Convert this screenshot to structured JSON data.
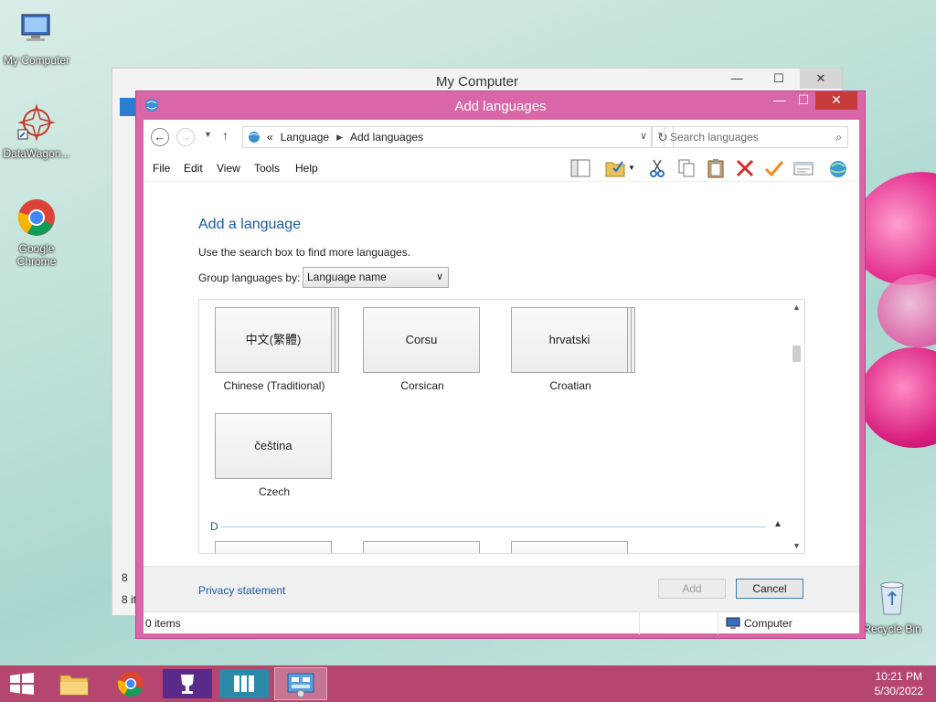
{
  "desktop": {
    "icons": [
      {
        "label": "My Computer"
      },
      {
        "label": "DataWagon..."
      },
      {
        "label": "Google Chrome"
      },
      {
        "label": "Recycle Bin"
      }
    ]
  },
  "back_window": {
    "title": "My Computer",
    "frag_top": "8",
    "frag_bottom": "8 it"
  },
  "dialog": {
    "title": "Add languages",
    "breadcrumb": {
      "prefix": "«",
      "items": [
        "Language",
        "Add languages"
      ]
    },
    "search_placeholder": "Search languages",
    "menu": [
      "File",
      "Edit",
      "View",
      "Tools",
      "Help"
    ],
    "heading": "Add a language",
    "hint": "Use the search box to find more languages.",
    "group_label": "Group languages by:",
    "group_value": "Language name",
    "languages": [
      {
        "native": "中文(繁體)",
        "name": "Chinese (Traditional)"
      },
      {
        "native": "Corsu",
        "name": "Corsican"
      },
      {
        "native": "hrvatski",
        "name": "Croatian"
      },
      {
        "native": "čeština",
        "name": "Czech"
      }
    ],
    "next_group": "D",
    "privacy": "Privacy statement",
    "add_button": "Add",
    "cancel_button": "Cancel",
    "status_left": "0 items",
    "status_right": "Computer"
  },
  "tray": {
    "time": "10:21 PM",
    "date": "5/30/2022"
  }
}
